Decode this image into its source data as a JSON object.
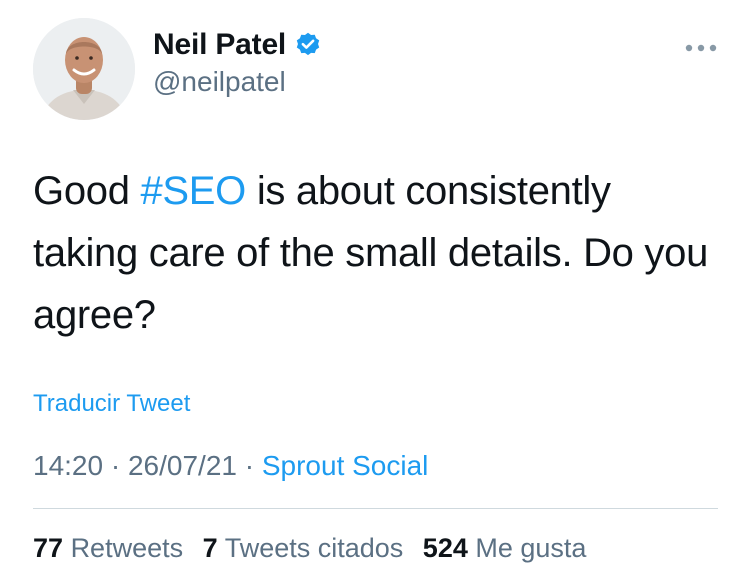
{
  "author": {
    "display_name": "Neil Patel",
    "handle": "@neilpatel",
    "verified": true,
    "avatar_icon": "profile-photo"
  },
  "tweet": {
    "text_before": "Good ",
    "hashtag": "#SEO",
    "text_after": " is about consistently taking care of the small details. Do you agree?"
  },
  "translate_label": "Traducir Tweet",
  "meta": {
    "time": "14:20",
    "separator": " · ",
    "date": "26/07/21",
    "source": "Sprout Social"
  },
  "stats": {
    "retweets_count": "77",
    "retweets_label": "Retweets",
    "quotes_count": "7",
    "quotes_label": "Tweets citados",
    "likes_count": "524",
    "likes_label": "Me gusta"
  },
  "colors": {
    "link": "#1d9bf0",
    "secondary_text": "#5b7083",
    "primary_text": "#0f1419",
    "divider": "#cfd9de"
  }
}
